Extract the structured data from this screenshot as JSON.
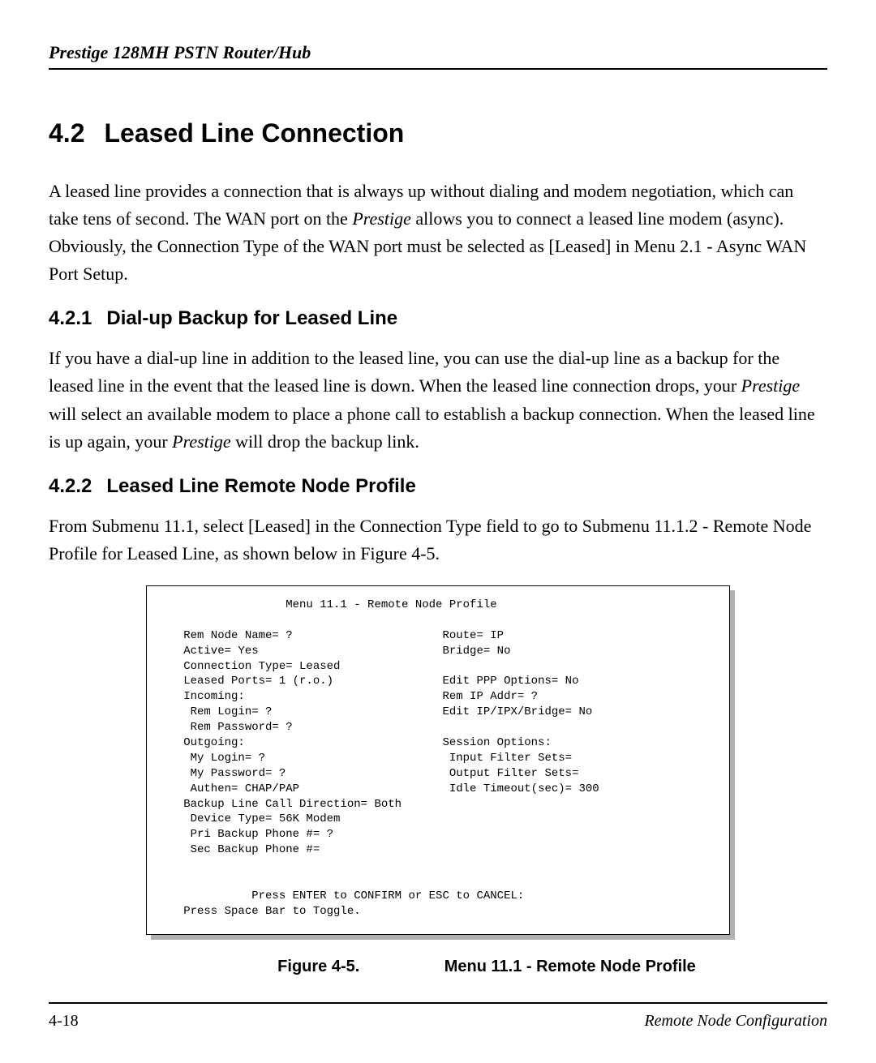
{
  "header": {
    "running": "Prestige 128MH  PSTN Router/Hub"
  },
  "section": {
    "number": "4.2",
    "title": "Leased Line Connection"
  },
  "paragraphs": {
    "p1a": "A leased line provides a connection that is always up without dialing and modem negotiation, which can take tens of second.  The WAN port on the ",
    "p1b": "Prestige",
    "p1c": " allows you to connect a leased line modem (async).  Obviously, the Connection Type of the WAN port must be selected as [Leased] in Menu 2.1 - Async WAN Port Setup."
  },
  "sub1": {
    "number": "4.2.1",
    "title": "Dial-up Backup for Leased Line",
    "p_a": "If you have a dial-up line in addition to the leased line, you can use the dial-up line as a backup for the leased line in the event that the leased line is down.  When the leased line connection drops, your ",
    "p_b": "Prestige",
    "p_c": " will select an available modem to place a phone call to establish a backup connection. When the leased line is up again, your ",
    "p_d": "Prestige",
    "p_e": " will drop the backup link."
  },
  "sub2": {
    "number": "4.2.2",
    "title": "Leased Line Remote Node Profile",
    "p": "From Submenu 11.1, select [Leased] in the Connection Type field to go to Submenu 11.1.2 - Remote Node Profile for Leased Line, as shown below in Figure 4-5."
  },
  "menu": {
    "title": "                  Menu 11.1 - Remote Node Profile",
    "l1": "   Rem Node Name= ?                      Route= IP",
    "l2": "   Active= Yes                           Bridge= No",
    "l3": "   Connection Type= Leased",
    "l4": "   Leased Ports= 1 (r.o.)                Edit PPP Options= No",
    "l5": "   Incoming:                             Rem IP Addr= ?",
    "l6": "    Rem Login= ?                         Edit IP/IPX/Bridge= No",
    "l7": "    Rem Password= ?",
    "l8": "   Outgoing:                             Session Options:",
    "l9": "    My Login= ?                           Input Filter Sets=",
    "l10": "    My Password= ?                        Output Filter Sets=",
    "l11": "    Authen= CHAP/PAP                      Idle Timeout(sec)= 300",
    "l12": "   Backup Line Call Direction= Both",
    "l13": "    Device Type= 56K Modem",
    "l14": "    Pri Backup Phone #= ?",
    "l15": "    Sec Backup Phone #=",
    "prompt1": "             Press ENTER to CONFIRM or ESC to CANCEL:",
    "prompt2": "   Press Space Bar to Toggle."
  },
  "figure": {
    "label": "Figure 4-5.",
    "title": "Menu 11.1 - Remote Node Profile"
  },
  "footer": {
    "page": "4-18",
    "section": "Remote Node Configuration"
  }
}
